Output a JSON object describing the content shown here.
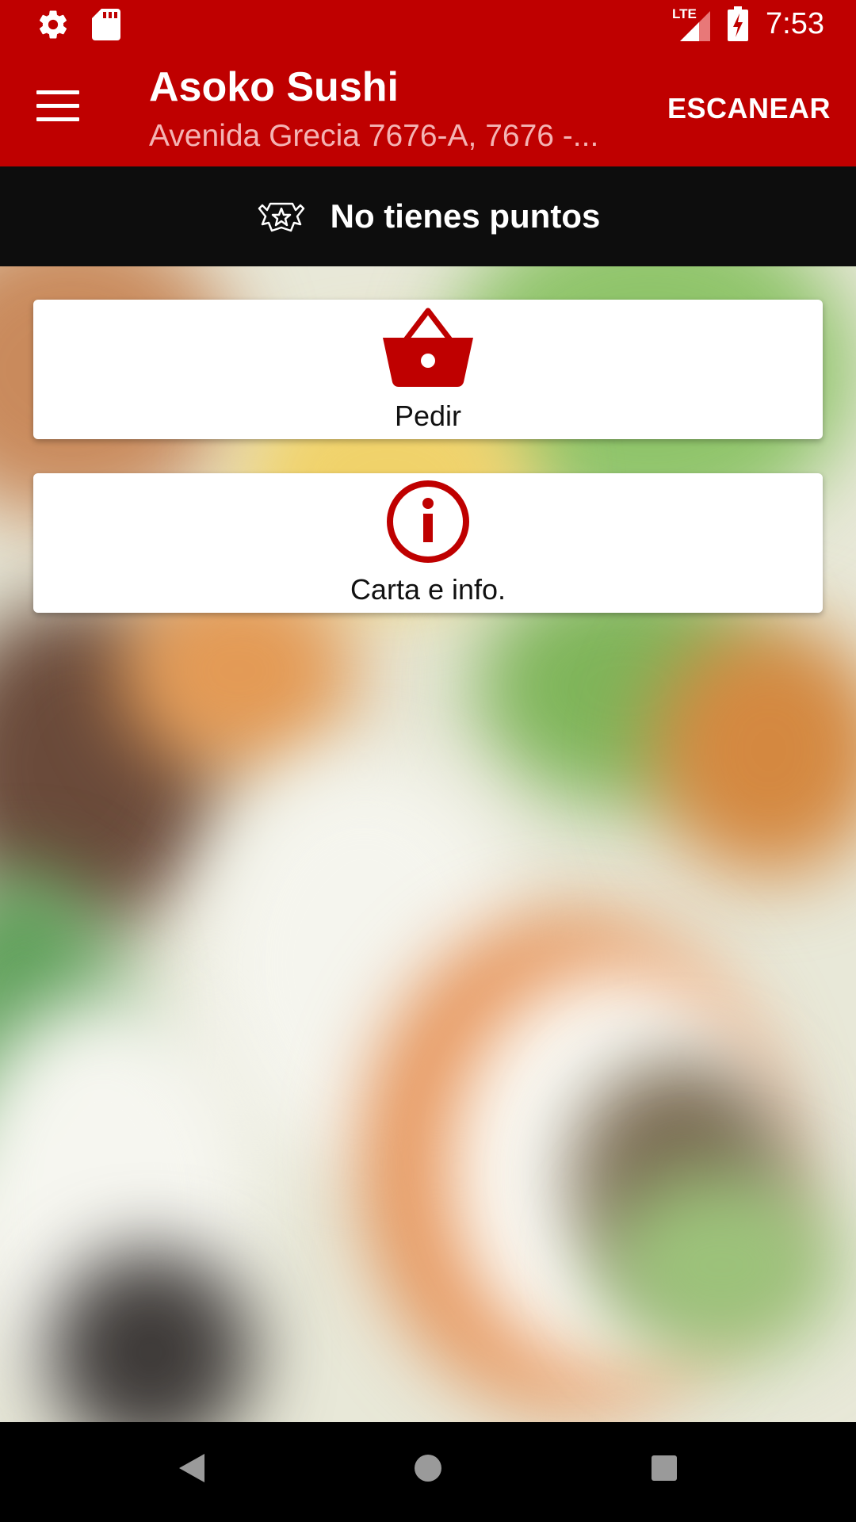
{
  "status_bar": {
    "time": "7:53",
    "network": "LTE"
  },
  "app_bar": {
    "title": "Asoko Sushi",
    "subtitle": "Avenida Grecia 7676-A, 7676 -...",
    "scan_label": "ESCANEAR"
  },
  "points": {
    "text": "No tienes puntos"
  },
  "actions": [
    {
      "label": "Pedir",
      "icon": "basket-icon"
    },
    {
      "label": "Carta e info.",
      "icon": "info-icon"
    }
  ],
  "colors": {
    "brand": "#bf0000",
    "points_bar": "#0d0d0d"
  }
}
